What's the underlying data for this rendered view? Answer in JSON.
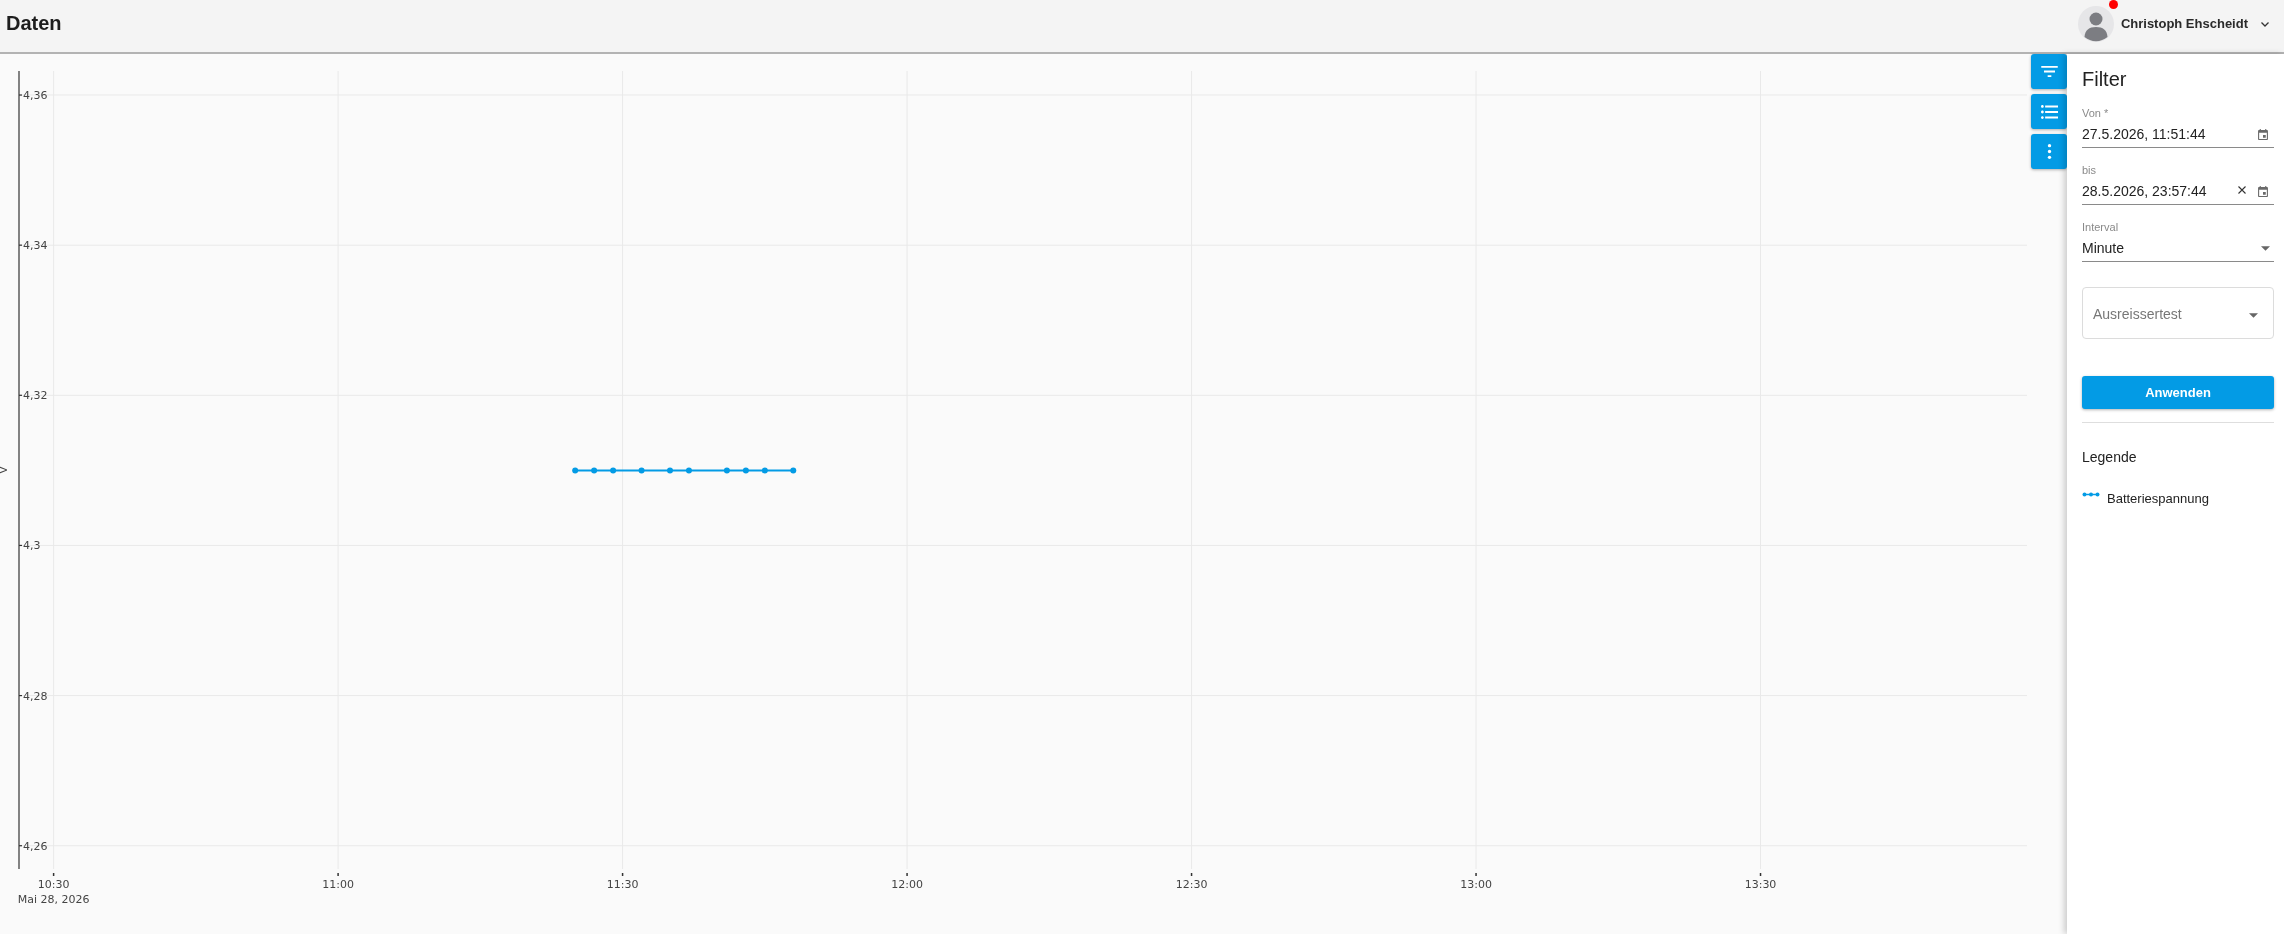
{
  "header": {
    "title": "Daten",
    "user": {
      "name": "Christoph Ehscheidt",
      "notification": true
    }
  },
  "chart": {
    "date_label": "Mai 28, 2026",
    "chart_data": {
      "type": "line",
      "ylabel": "V",
      "grid": true,
      "x": [
        685,
        687,
        689,
        692,
        695,
        697,
        701,
        703,
        705,
        708
      ],
      "series": [
        {
          "name": "Batteriespannung",
          "color": "#039be5",
          "marker": "circle",
          "values": [
            4.31,
            4.31,
            4.31,
            4.31,
            4.31,
            4.31,
            4.31,
            4.31,
            4.31,
            4.31
          ]
        }
      ],
      "xlim": [
        626.35,
        838.1
      ],
      "ylim": [
        4.2569,
        4.3632
      ],
      "xticks": [
        {
          "value": 630,
          "label": "10:30"
        },
        {
          "value": 660,
          "label": "11:00"
        },
        {
          "value": 690,
          "label": "11:30"
        },
        {
          "value": 720,
          "label": "12:00"
        },
        {
          "value": 750,
          "label": "12:30"
        },
        {
          "value": 780,
          "label": "13:00"
        },
        {
          "value": 810,
          "label": "13:30"
        }
      ],
      "yticks": [
        {
          "value": 4.26,
          "label": "4,26"
        },
        {
          "value": 4.28,
          "label": "4,28"
        },
        {
          "value": 4.3,
          "label": "4,3"
        },
        {
          "value": 4.32,
          "label": "4,32"
        },
        {
          "value": 4.34,
          "label": "4,34"
        },
        {
          "value": 4.36,
          "label": "4,36"
        }
      ]
    }
  },
  "toolbar": [
    {
      "kind": "filter"
    },
    {
      "kind": "list"
    },
    {
      "kind": "more"
    }
  ],
  "filter_panel": {
    "title": "Filter",
    "fields": [
      {
        "kind": "datetime",
        "label": "Von *",
        "value": "27.5.2026, 11:51:44",
        "clearable": false
      },
      {
        "kind": "datetime",
        "label": "bis",
        "value": "28.5.2026, 23:57:44",
        "clearable": true
      },
      {
        "kind": "select",
        "label": "Interval",
        "value": "Minute"
      },
      {
        "kind": "outlined-select",
        "placeholder": "Ausreissertest"
      }
    ],
    "apply_button": "Anwenden",
    "legend_title": "Legende"
  }
}
